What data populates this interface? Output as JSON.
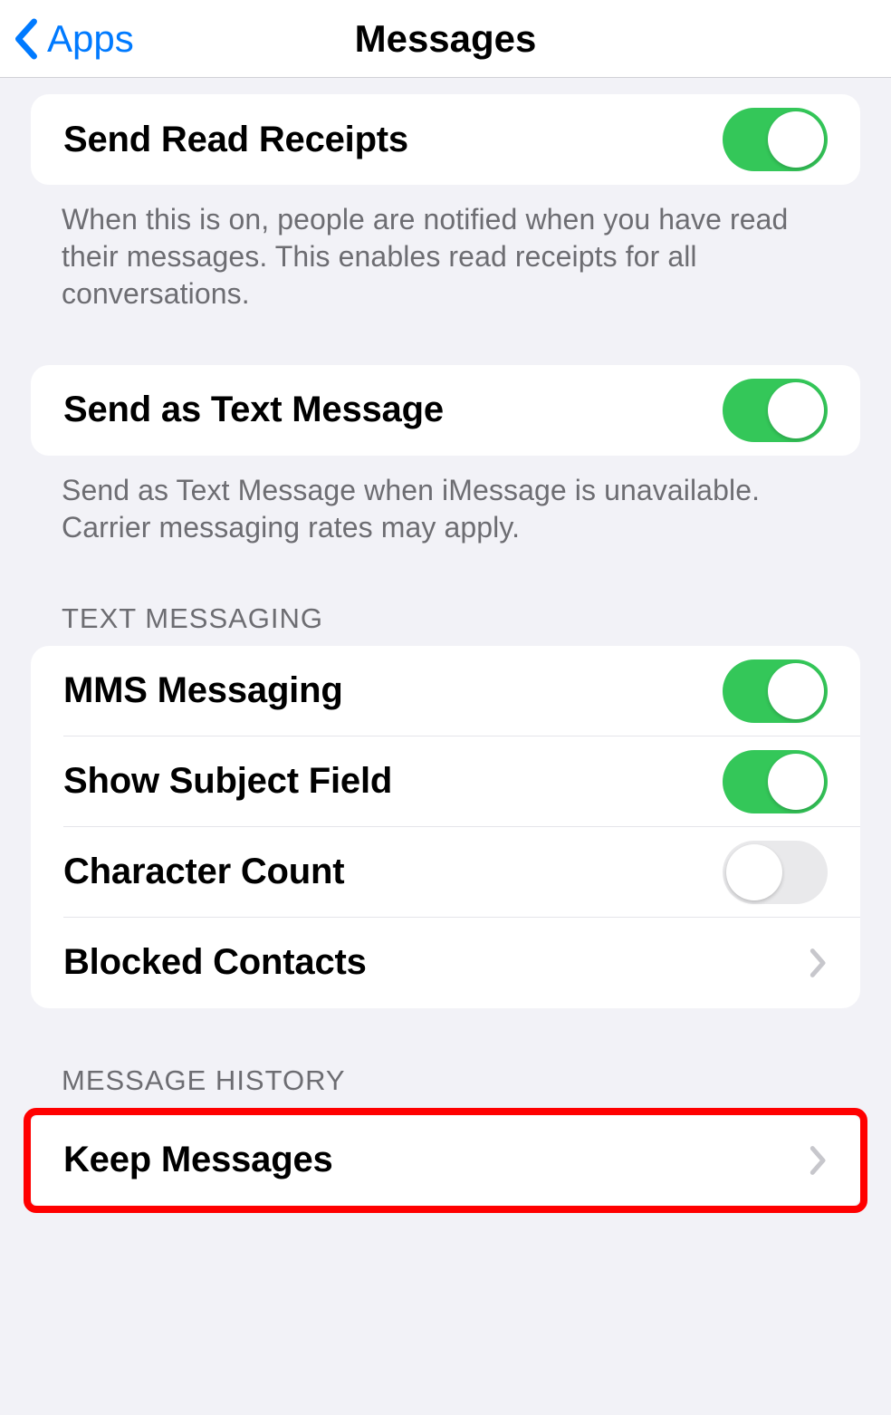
{
  "nav": {
    "back_label": "Apps",
    "title": "Messages"
  },
  "read_receipts": {
    "label": "Send Read Receipts",
    "description": "When this is on, people are notified when you have read their messages. This enables read receipts for all conversations.",
    "enabled": true
  },
  "send_as_text": {
    "label": "Send as Text Message",
    "description": "Send as Text Message when iMessage is unavailable. Carrier messaging rates may apply.",
    "enabled": true
  },
  "text_messaging": {
    "header": "TEXT MESSAGING",
    "mms": {
      "label": "MMS Messaging",
      "enabled": true
    },
    "subject": {
      "label": "Show Subject Field",
      "enabled": true
    },
    "char_count": {
      "label": "Character Count",
      "enabled": false
    },
    "blocked": {
      "label": "Blocked Contacts"
    }
  },
  "message_history": {
    "header": "MESSAGE HISTORY",
    "keep": {
      "label": "Keep Messages"
    }
  },
  "highlight": "keep_messages"
}
